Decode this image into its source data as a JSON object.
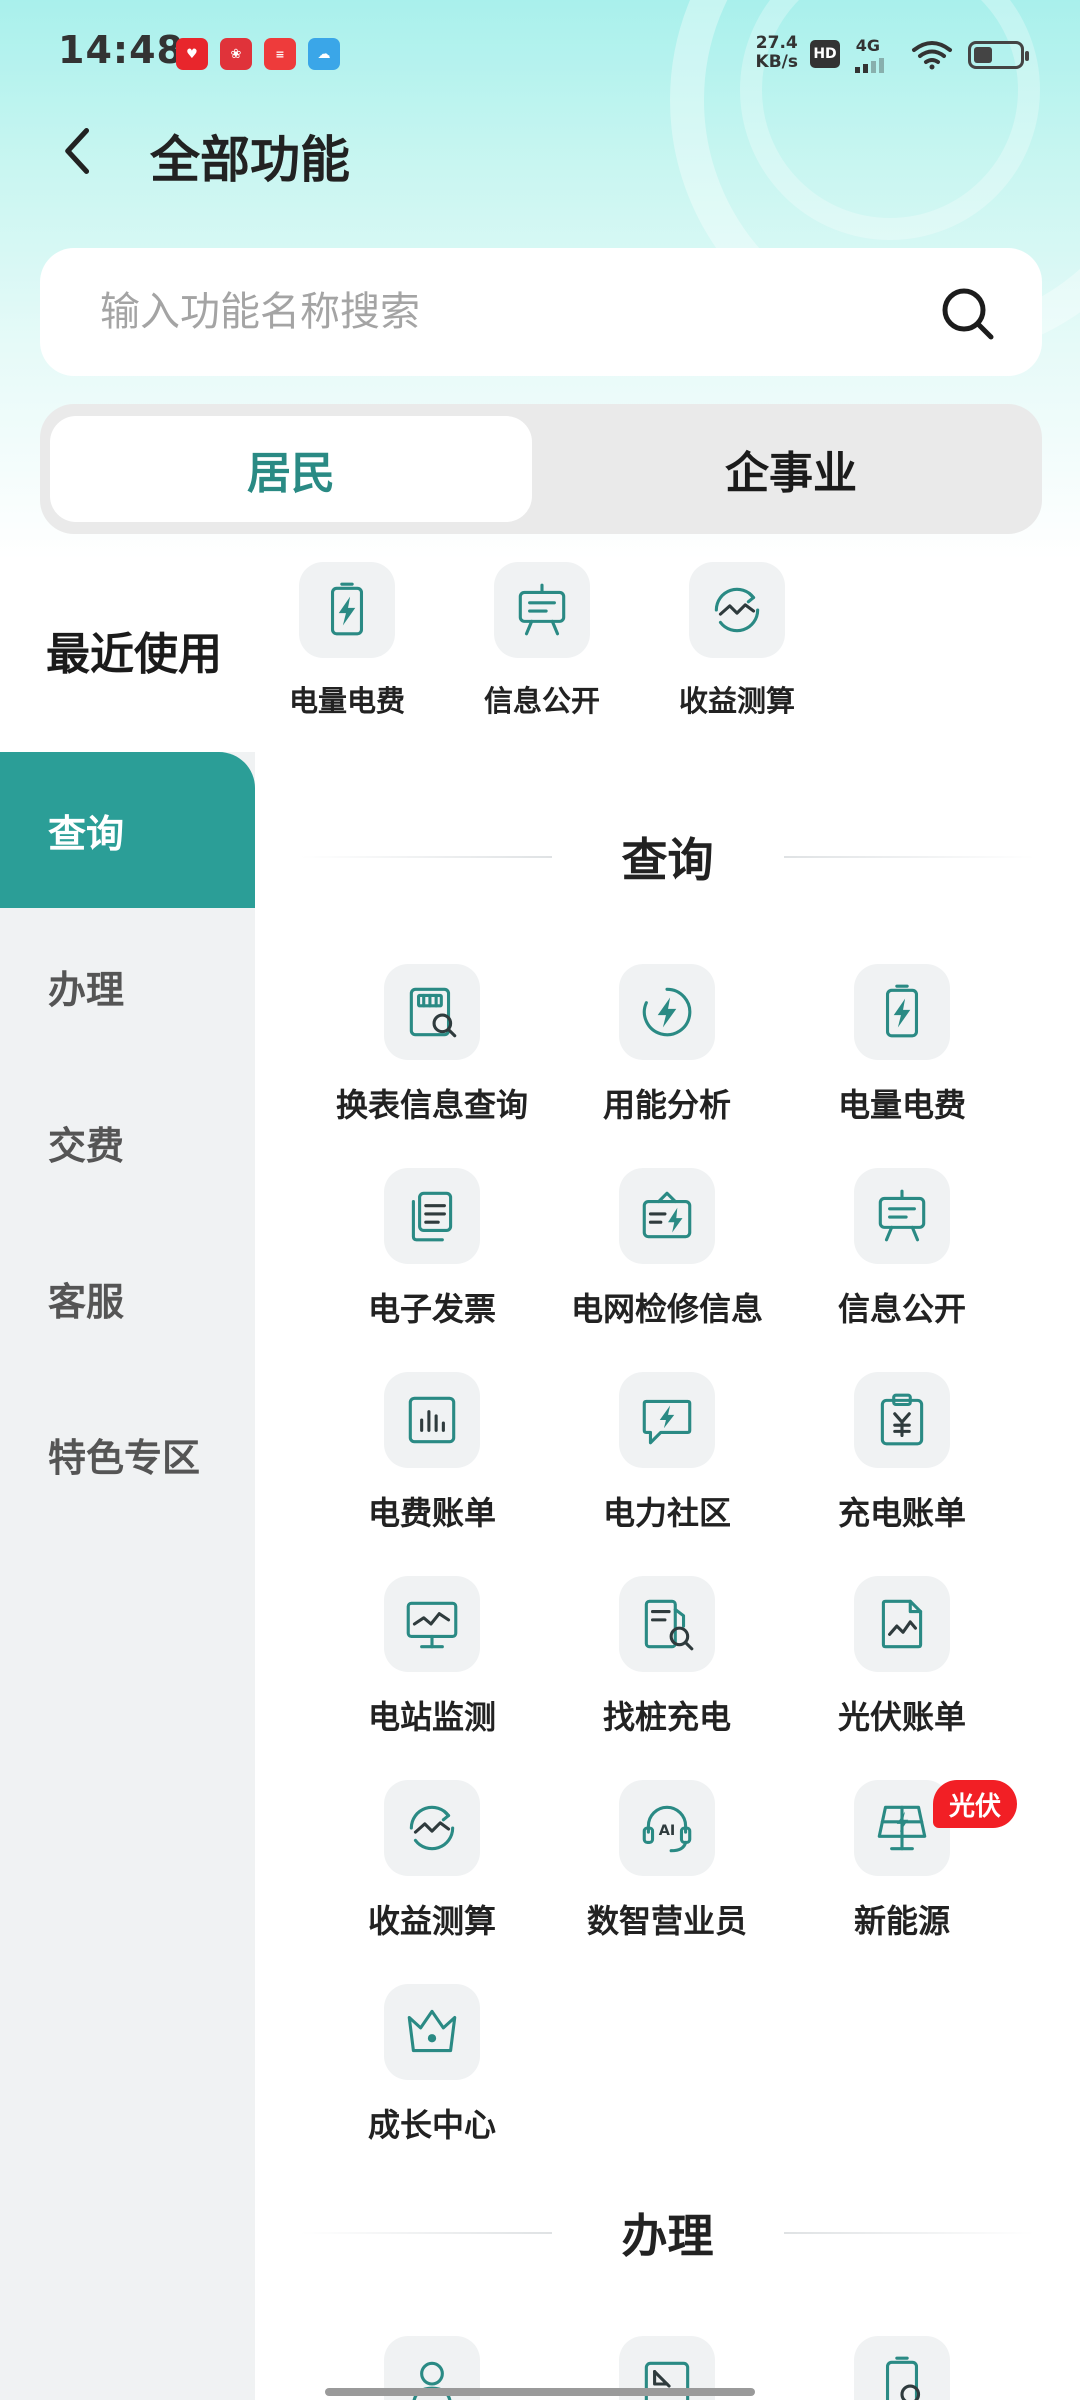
{
  "status_bar": {
    "time": "14:48",
    "speed_value": "27.4",
    "speed_unit": "KB/s",
    "hd": "HD",
    "network": "4G",
    "battery_level": 0.35
  },
  "header": {
    "back_icon": "chevron-left-icon",
    "title": "全部功能"
  },
  "search": {
    "placeholder": "输入功能名称搜索",
    "value": "",
    "icon": "search-icon"
  },
  "segment": {
    "tabs": [
      {
        "label": "居民",
        "active": true
      },
      {
        "label": "企事业",
        "active": false
      }
    ]
  },
  "recent": {
    "label": "最近使用",
    "items": [
      {
        "label": "电量电费",
        "icon": "battery-bolt-icon"
      },
      {
        "label": "信息公开",
        "icon": "presentation-board-icon"
      },
      {
        "label": "收益测算",
        "icon": "gauge-trend-icon"
      }
    ]
  },
  "sidebar": {
    "items": [
      {
        "label": "查询",
        "active": true
      },
      {
        "label": "办理",
        "active": false
      },
      {
        "label": "交费",
        "active": false
      },
      {
        "label": "客服",
        "active": false
      },
      {
        "label": "特色专区",
        "active": false
      }
    ]
  },
  "sections": [
    {
      "title": "查询",
      "items": [
        {
          "label": "换表信息查询",
          "icon": "meter-search-icon"
        },
        {
          "label": "用能分析",
          "icon": "energy-bolt-icon"
        },
        {
          "label": "电量电费",
          "icon": "battery-bolt-icon"
        },
        {
          "label": "电子发票",
          "icon": "invoice-icon"
        },
        {
          "label": "电网检修信息",
          "icon": "maintenance-bag-icon"
        },
        {
          "label": "信息公开",
          "icon": "presentation-board-icon"
        },
        {
          "label": "电费账单",
          "icon": "bar-chart-icon"
        },
        {
          "label": "电力社区",
          "icon": "chat-bolt-icon"
        },
        {
          "label": "充电账单",
          "icon": "clipboard-yuan-icon"
        },
        {
          "label": "电站监测",
          "icon": "monitor-icon"
        },
        {
          "label": "找桩充电",
          "icon": "charger-search-icon"
        },
        {
          "label": "光伏账单",
          "icon": "solar-bill-icon"
        },
        {
          "label": "收益测算",
          "icon": "gauge-trend-icon"
        },
        {
          "label": "数智营业员",
          "icon": "ai-headset-icon"
        },
        {
          "label": "新能源",
          "icon": "solar-panel-icon",
          "badge": "光伏"
        },
        {
          "label": "成长中心",
          "icon": "crown-icon"
        }
      ]
    },
    {
      "title": "办理"
    }
  ],
  "colors": {
    "accent": "#2b9e97",
    "accent_text": "#2a8a84",
    "badge_red": "#f21f25"
  }
}
